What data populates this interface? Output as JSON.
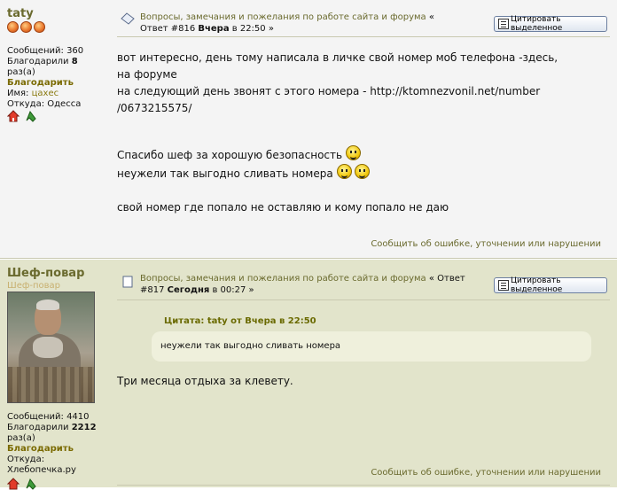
{
  "post1": {
    "author": "taty",
    "stats": {
      "messages_label": "Сообщений:",
      "messages_value": "360",
      "thanked_label": "Благодарили",
      "thanked_value": "8",
      "times_label": "раз(а)",
      "thank_link": "Благодарить",
      "name_label": "Имя:",
      "name_value": "цахес",
      "from_label": "Откуда:",
      "from_value": "Одесса"
    },
    "topic_link": "Вопросы, замечания и пожелания по работе сайта и форума",
    "topic_suffix": " «",
    "reply_line_prefix": "Ответ #816 ",
    "reply_day": "Вчера",
    "reply_time": " в 22:50 »",
    "quote_button": "Цитировать выделенное",
    "body_lines": [
      "вот интересно, день тому написала в личке свой номер моб телефона -здесь,",
      "на форуме",
      "на следующий день звонят с этого номера - http://ktomnezvonil.net/number",
      "/0673215575/"
    ],
    "body_thanks": "Спасибо шеф за хорошую безопасность",
    "body_question": "неужели так выгодно сливать номера",
    "body_last": "свой номер где попало не оставляю и кому попало не даю",
    "report_link": "Сообщить об ошибке, уточнении или нарушении"
  },
  "post2": {
    "author": "Шеф-повар",
    "subtitle": "Шеф-повар",
    "stats": {
      "messages_label": "Сообщений:",
      "messages_value": "4410",
      "thanked_label": "Благодарили",
      "thanked_value": "2212",
      "times_label": "раз(а)",
      "thank_link": "Благодарить",
      "from_label": "Откуда:",
      "from_value": "Хлебопечка.ру"
    },
    "topic_link": "Вопросы, замечания и пожелания по работе сайта и форума",
    "topic_suffix": " « Ответ",
    "reply_line_prefix": "#817 ",
    "reply_day": "Сегодня",
    "reply_time": " в 00:27 »",
    "quote_button": "Цитировать выделенное",
    "quote_header": "Цитата: taty от Вчера в 22:50",
    "quote_text": "неужели так выгодно сливать номера",
    "body": "Три месяца отдыха за клевету.",
    "report_link": "Сообщить об ошибке, уточнении или нарушении"
  }
}
